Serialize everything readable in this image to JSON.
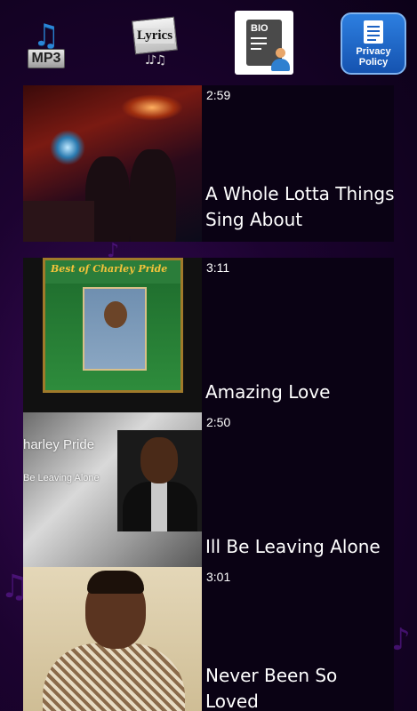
{
  "topbar": {
    "mp3_label": "MP3",
    "lyrics_label": "Lyrics",
    "bio_label": "BIO",
    "privacy_label": "Privacy Policy"
  },
  "songs": [
    {
      "duration": "2:59",
      "title": "A Whole Lotta Things Sing About"
    },
    {
      "duration": "3:11",
      "title": "Amazing Love",
      "cover_header": "Best of Charley Pride"
    },
    {
      "duration": "2:50",
      "title": "Ill Be Leaving Alone",
      "thumb_text_1": "harley Pride",
      "thumb_text_2": "Be Leaving Alone"
    },
    {
      "duration": "3:01",
      "title": "Never Been So Loved"
    }
  ],
  "colors": {
    "background": "#1c0330",
    "card": "#0a0214",
    "accent_notes": "#6a1fa8",
    "privacy_button": "#1e63c4"
  }
}
